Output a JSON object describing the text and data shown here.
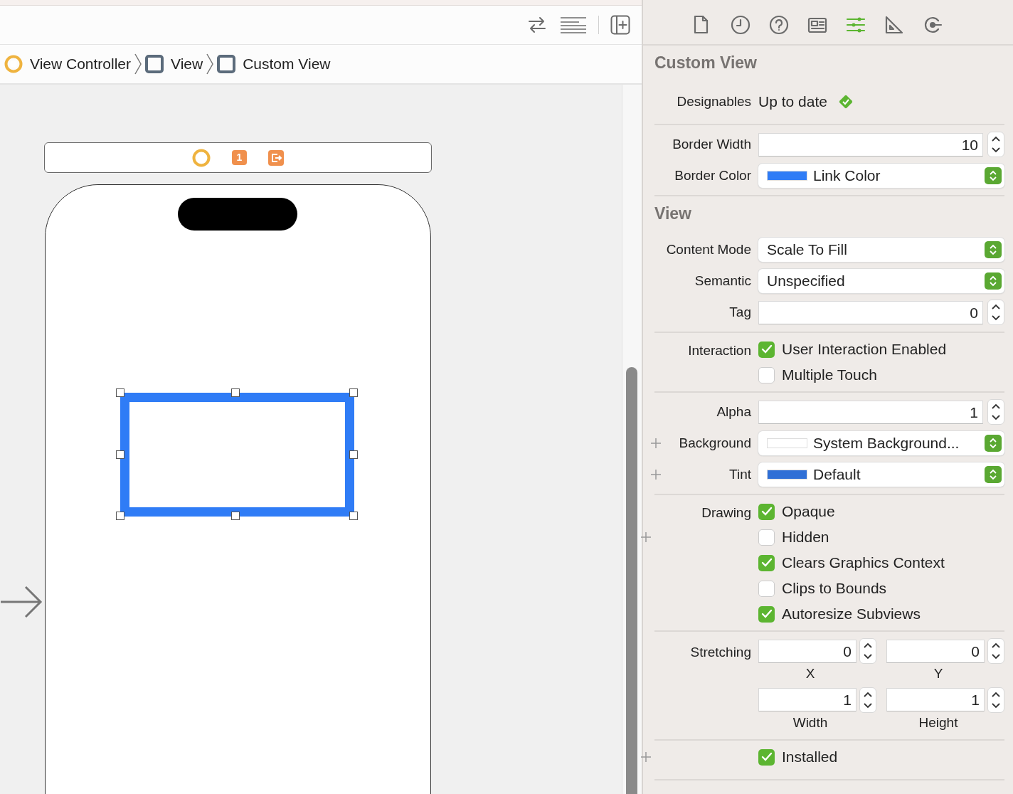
{
  "toolbar": {
    "buttons": [
      {
        "kind": "swap"
      },
      {
        "kind": "lines"
      },
      {
        "kind": "add-editor"
      }
    ]
  },
  "breadcrumb": [
    {
      "label": "View Controller",
      "kind": "controller"
    },
    {
      "label": "View",
      "kind": "view"
    },
    {
      "label": "Custom View",
      "kind": "view"
    }
  ],
  "canvas": {
    "scene_dock": [
      {
        "kind": "controller"
      },
      {
        "kind": "responder",
        "text": "1"
      },
      {
        "kind": "exit"
      }
    ],
    "custom_view": {
      "selected": true
    },
    "entry_arrow": true
  },
  "inspector": {
    "tabs": [
      {
        "kind": "file",
        "selected": false
      },
      {
        "kind": "history",
        "selected": false
      },
      {
        "kind": "help",
        "selected": false
      },
      {
        "kind": "identity",
        "selected": false
      },
      {
        "kind": "attributes",
        "selected": true
      },
      {
        "kind": "size",
        "selected": false
      },
      {
        "kind": "connections",
        "selected": false
      }
    ],
    "sections": [
      {
        "title": "Custom View",
        "groups": [
          [
            {
              "kind": "status",
              "label": "Designables",
              "value": "Up to date"
            }
          ],
          [
            {
              "kind": "stepper",
              "label": "Border Width",
              "value": "10"
            },
            {
              "kind": "color",
              "label": "Border Color",
              "value": "Link Color",
              "color": "#2f7cf6",
              "plus": false
            }
          ]
        ]
      },
      {
        "title": "View",
        "groups": [
          [
            {
              "kind": "popup",
              "label": "Content Mode",
              "value": "Scale To Fill"
            },
            {
              "kind": "popup",
              "label": "Semantic",
              "value": "Unspecified"
            },
            {
              "kind": "stepper",
              "label": "Tag",
              "value": "0"
            }
          ],
          [
            {
              "kind": "checks",
              "label": "Interaction",
              "items": [
                {
                  "label": "User Interaction Enabled",
                  "checked": true,
                  "plus": false
                },
                {
                  "label": "Multiple Touch",
                  "checked": false,
                  "plus": false
                }
              ]
            }
          ],
          [
            {
              "kind": "stepper",
              "label": "Alpha",
              "value": "1"
            },
            {
              "kind": "color",
              "label": "Background",
              "value": "System Background...",
              "color": "#ffffff",
              "plus": true
            },
            {
              "kind": "color",
              "label": "Tint",
              "value": "Default",
              "color": "#2f6fd6",
              "plus": true
            }
          ],
          [
            {
              "kind": "checks",
              "label": "Drawing",
              "items": [
                {
                  "label": "Opaque",
                  "checked": true,
                  "plus": false
                },
                {
                  "label": "Hidden",
                  "checked": false,
                  "plus": true
                },
                {
                  "label": "Clears Graphics Context",
                  "checked": true,
                  "plus": false
                },
                {
                  "label": "Clips to Bounds",
                  "checked": false,
                  "plus": false
                },
                {
                  "label": "Autoresize Subviews",
                  "checked": true,
                  "plus": false
                }
              ]
            }
          ],
          [
            {
              "kind": "pairs",
              "label": "Stretching",
              "fields": [
                {
                  "value": "0",
                  "caption": "X"
                },
                {
                  "value": "0",
                  "caption": "Y"
                },
                {
                  "value": "1",
                  "caption": "Width"
                },
                {
                  "value": "1",
                  "caption": "Height"
                }
              ]
            }
          ],
          [
            {
              "kind": "checks",
              "items": [
                {
                  "label": "Installed",
                  "checked": true,
                  "plus": true
                }
              ]
            }
          ]
        ]
      }
    ]
  }
}
